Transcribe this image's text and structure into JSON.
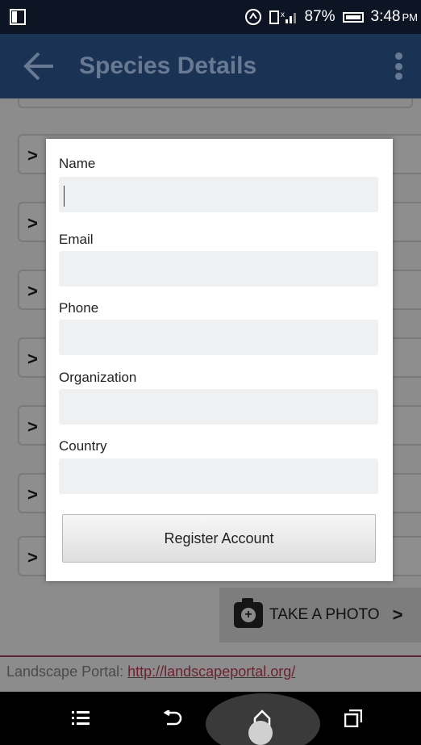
{
  "status_bar": {
    "battery": "87%",
    "time": "3:48",
    "ampm": "PM"
  },
  "app_bar": {
    "title": "Species Details"
  },
  "form": {
    "fields": [
      {
        "label": "Name",
        "value": ""
      },
      {
        "label": "Email",
        "value": ""
      },
      {
        "label": "Phone",
        "value": ""
      },
      {
        "label": "Organization",
        "value": ""
      },
      {
        "label": "Country",
        "value": ""
      }
    ],
    "submit_label": "Register Account"
  },
  "content": {
    "take_photo_label": "TAKE A PHOTO",
    "portal_prefix": "Landscape Portal: ",
    "portal_link": "http://landscapeportal.org/",
    "row_chevron": ">"
  }
}
